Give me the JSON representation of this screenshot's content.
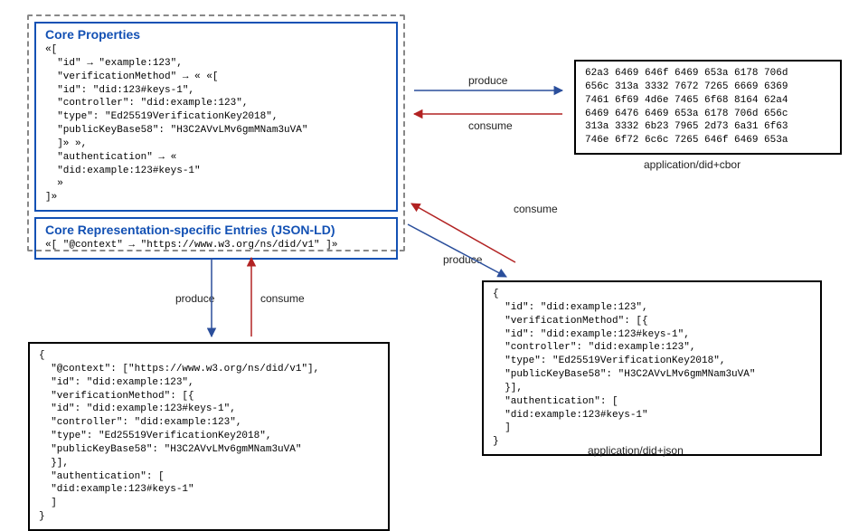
{
  "core": {
    "propertiesTitle": "Core Properties",
    "propertiesBody": "«[\n  \"id\" → \"example:123\",\n  \"verificationMethod\" → « «[\n  \"id\": \"did:123#keys-1\",\n  \"controller\": \"did:example:123\",\n  \"type\": \"Ed25519VerificationKey2018\",\n  \"publicKeyBase58\": \"H3C2AVvLMv6gmMNam3uVA\"\n  ]» »,\n  \"authentication\" → «\n  \"did:example:123#keys-1\"\n  »\n]»",
    "repTitle": "Core Representation-specific Entries (JSON-LD)",
    "repBody": "«[ \"@context\" → \"https://www.w3.org/ns/did/v1\" ]»"
  },
  "cbor": {
    "body": "62a3 6469 646f 6469 653a 6178 706d\n656c 313a 3332 7672 7265 6669 6369\n7461 6f69 4d6e 7465 6f68 8164 62a4\n6469 6476 6469 653a 6178 706d 656c\n313a 3332 6b23 7965 2d73 6a31 6f63\n746e 6f72 6c6c 7265 646f 6469 653a",
    "caption": "application/did+cbor"
  },
  "json": {
    "body": "{\n  \"id\": \"did:example:123\",\n  \"verificationMethod\": [{\n  \"id\": \"did:example:123#keys-1\",\n  \"controller\": \"did:example:123\",\n  \"type\": \"Ed25519VerificationKey2018\",\n  \"publicKeyBase58\": \"H3C2AVvLMv6gmMNam3uVA\"\n  }],\n  \"authentication\": [\n  \"did:example:123#keys-1\"\n  ]\n}",
    "caption": "application/did+json"
  },
  "jsonld": {
    "body": "{\n  \"@context\": [\"https://www.w3.org/ns/did/v1\"],\n  \"id\": \"did:example:123\",\n  \"verificationMethod\": [{\n  \"id\": \"did:example:123#keys-1\",\n  \"controller\": \"did:example:123\",\n  \"type\": \"Ed25519VerificationKey2018\",\n  \"publicKeyBase58\": \"H3C2AVvLMv6gmMNam3uVA\"\n  }],\n  \"authentication\": [\n  \"did:example:123#keys-1\"\n  ]\n}"
  },
  "labels": {
    "produce": "produce",
    "consume": "consume"
  }
}
